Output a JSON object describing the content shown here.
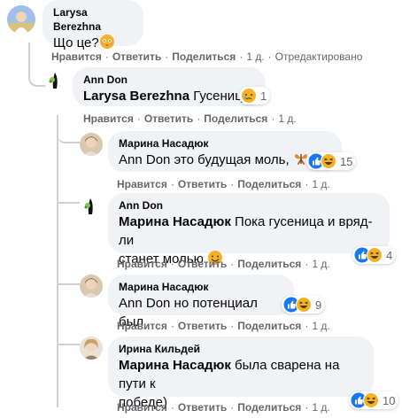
{
  "comments": [
    {
      "author": "Larysa Berezhna",
      "text": "Що це?",
      "actions": {
        "like": "Нравится",
        "reply": "Ответить",
        "share": "Поделиться",
        "time": "1 д.",
        "edited": "Отредактировано"
      }
    },
    {
      "author": "Ann Don",
      "mention": "Larysa Berezhna",
      "text": "Гусеница",
      "reaction_count": "1",
      "actions": {
        "like": "Нравится",
        "reply": "Ответить",
        "share": "Поделиться",
        "time": "1 д."
      }
    },
    {
      "author": "Марина Насадюк",
      "text": "Ann Don это будущая моль,",
      "reaction_count": "15",
      "actions": {
        "like": "Нравится",
        "reply": "Ответить",
        "share": "Поделиться",
        "time": "1 д."
      }
    },
    {
      "author": "Ann Don",
      "mention": "Марина Насадюк",
      "text_line1": "Пока гусеница и вряд-ли",
      "text_line2": "станет молью",
      "reaction_count": "4",
      "actions": {
        "like": "Нравится",
        "reply": "Ответить",
        "share": "Поделиться",
        "time": "1 д."
      }
    },
    {
      "author": "Марина Насадюк",
      "text": "Ann Don но потенциал был",
      "reaction_count": "9",
      "actions": {
        "like": "Нравится",
        "reply": "Ответить",
        "share": "Поделиться",
        "time": "1 д."
      }
    },
    {
      "author": "Ирина Кильдей",
      "mention": "Марина Насадюк",
      "text_line1": "была сварена на пути к",
      "text_line2": "победе)",
      "reaction_count": "10",
      "actions": {
        "like": "Нравится",
        "reply": "Ответить",
        "share": "Поделиться",
        "time": "1 д."
      }
    }
  ],
  "colors": {
    "bubble": "#f0f2f5",
    "meta": "#65676b",
    "like_blue": "#1877f2",
    "haha_yellow": "#f7b125"
  }
}
